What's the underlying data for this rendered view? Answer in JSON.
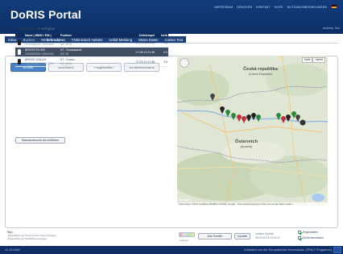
{
  "app": {
    "title": "DoRIS Portal"
  },
  "toplinks": [
    "IMPRESSUM",
    "DRUCKEN",
    "KONTAKT",
    "HILFE",
    "NUTZUNGSBEDINGUNGEN"
  ],
  "user": "Andreas, Sus",
  "nav": [
    {
      "label": "Inbox",
      "active": false
    },
    {
      "label": "Suchen",
      "active": false
    },
    {
      "label": "Verkehrsdaten",
      "active": true
    },
    {
      "label": "Elektronisch melden",
      "active": false
    },
    {
      "label": "Unfall Meldung",
      "active": false
    },
    {
      "label": "Meine Daten",
      "active": false
    },
    {
      "label": "Contex Test",
      "active": false
    }
  ],
  "tabs": [
    {
      "label": "Schiffe",
      "active": true
    },
    {
      "label": "Schiffsinfo",
      "active": false
    },
    {
      "label": "Pegelstellen",
      "active": false
    },
    {
      "label": "Schleusenstatus",
      "active": false
    }
  ],
  "list": {
    "title": "Schiffsliste",
    "count_text": "- 3 verfügbar"
  },
  "table": {
    "headers": [
      "Name ( MMSI / ENI )",
      "Position",
      "Zeitstempel",
      "km/h"
    ],
    "rows": [
      {
        "name": "ARGOS GALLIO",
        "ids": "2033000001 / 8001000",
        "pos1": "AT - Donau -",
        "pos2": "DO 1878",
        "time": "27.09.13 21:38",
        "speed": "3.8",
        "selected": false
      },
      {
        "name": "ARGOS ELLEN",
        "ids": "2033000002 / 8001002",
        "pos1": "AT - Donaukanal -",
        "pos2": "DO 18",
        "time": "27.09.13 21:38",
        "speed": "0.0",
        "selected": true
      },
      {
        "name": "ARGOS GALLIO",
        "ids": "2033000003 / 8001003",
        "pos1": "AT - Donau -",
        "pos2": "DO 1878",
        "time": "27.09.13 21:38",
        "speed": "3.8",
        "selected": false
      }
    ]
  },
  "standard_button": "Standardsuche durchführen",
  "map": {
    "type_buttons": [
      "Karte",
      "Hybrid"
    ],
    "labels": [
      {
        "name": "Česká republika",
        "sub": "(Czech Republic)"
      },
      {
        "name": "Österreich",
        "sub": "(Austria)"
      }
    ],
    "footer": "Kartendaten ©2013 GeoBasis-DE/BKG (©2009), Google · Nutzungsbedingungen  Fehler bei Google Maps melden",
    "google": "Google"
  },
  "map_controls": {
    "legend_caption": "Legende",
    "all_ships_button": "Alle Schiffe",
    "update_button": "Update",
    "update_info_label": "Letztes Update",
    "update_info_time": "08.03.2014 15:42:01",
    "checkboxes": [
      "Pegelstellen",
      "Schleusenstatus"
    ]
  },
  "tips": {
    "title": "Tipp:",
    "lines": [
      "- Doppelklick auf Schiff auf der Karte anzeigen",
      "- Doppelklick auf Schiffsliste anzeigen"
    ]
  },
  "footer": {
    "version": "v1.13.4652",
    "funding": "Gefördert von der Europäischen Kommission (TEN-T Programm)"
  },
  "colors": {
    "header": "#123c7a",
    "active_tab": "#4a83c7",
    "selected_row": "#3e4d62"
  }
}
